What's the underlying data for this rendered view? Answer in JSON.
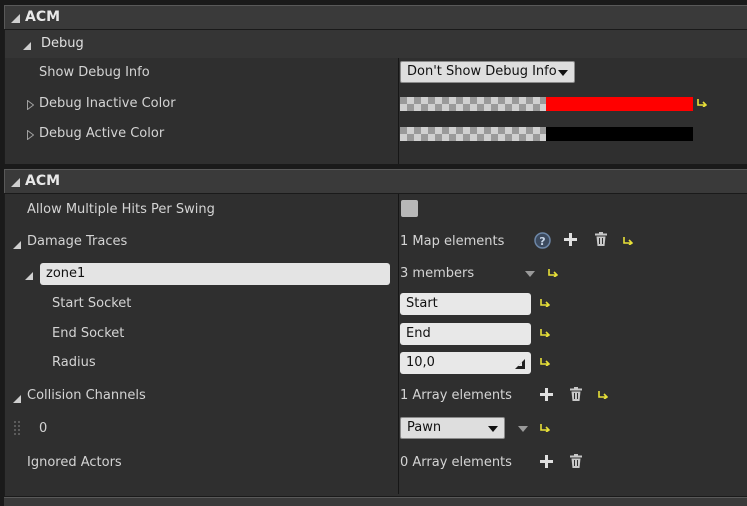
{
  "sections": {
    "acm1": {
      "title": "ACM",
      "debug": {
        "title": "Debug",
        "show_debug_info": {
          "label": "Show Debug Info",
          "value": "Don't Show Debug Info"
        },
        "inactive_color": {
          "label": "Debug Inactive Color",
          "color": "#ff0000"
        },
        "active_color": {
          "label": "Debug Active Color",
          "color": "#000000"
        }
      }
    },
    "acm2": {
      "title": "ACM",
      "allow_multi": {
        "label": "Allow Multiple Hits Per Swing"
      },
      "damage_traces": {
        "label": "Damage Traces",
        "count": "1 Map elements",
        "entry": {
          "key": "zone1",
          "members": "3 members",
          "start_socket": {
            "label": "Start Socket",
            "value": "Start"
          },
          "end_socket": {
            "label": "End Socket",
            "value": "End"
          },
          "radius": {
            "label": "Radius",
            "value": "10,0"
          }
        }
      },
      "collision_channels": {
        "label": "Collision Channels",
        "count": "1 Array elements",
        "item": {
          "index": "0",
          "value": "Pawn"
        }
      },
      "ignored_actors": {
        "label": "Ignored Actors",
        "count": "0 Array elements"
      }
    }
  },
  "colors": {
    "reset_arrow": "#e8e038",
    "inactive": "#ff0000",
    "active": "#000000"
  }
}
